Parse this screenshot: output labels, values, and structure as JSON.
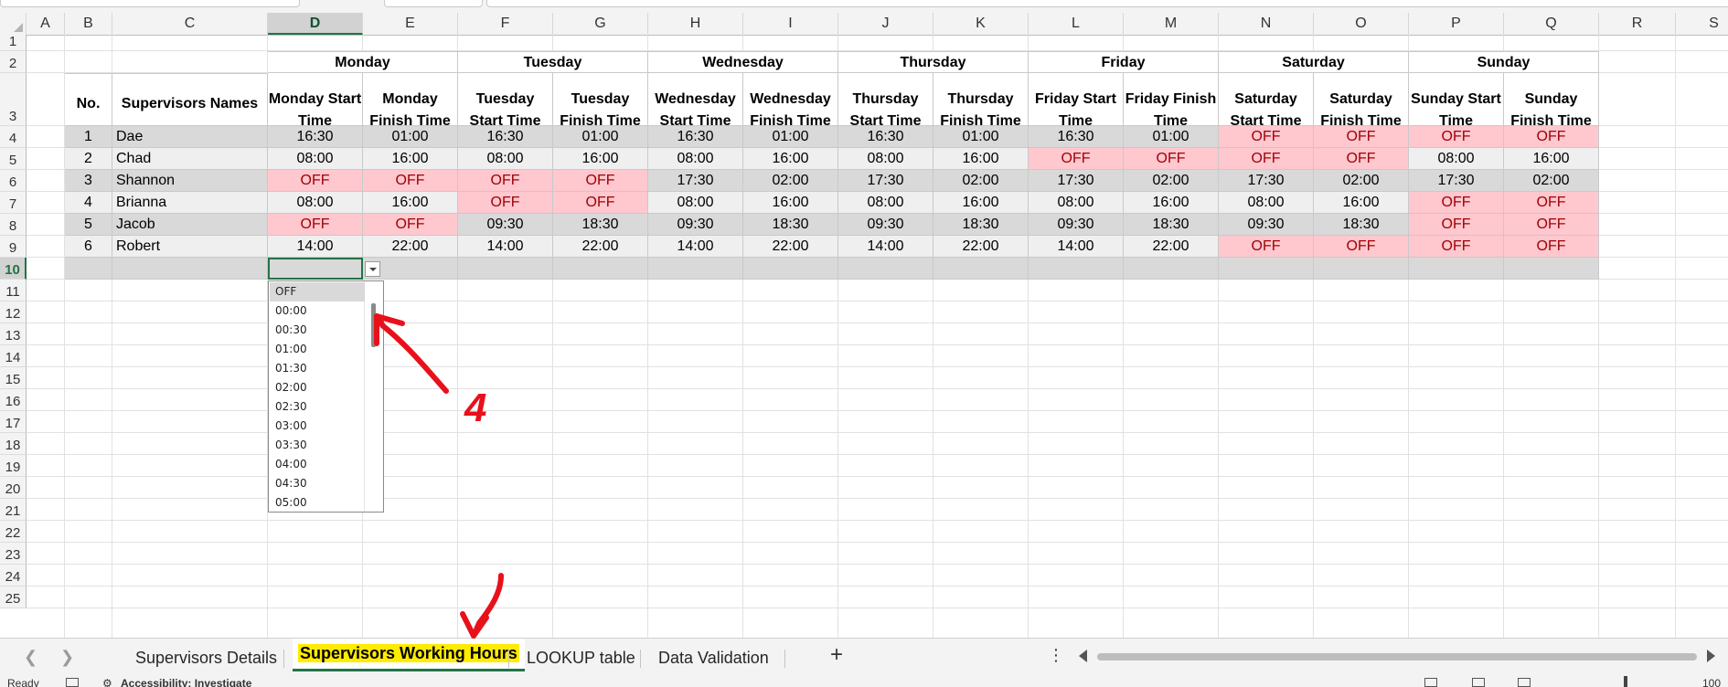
{
  "columns": [
    "A",
    "B",
    "C",
    "D",
    "E",
    "F",
    "G",
    "H",
    "I",
    "J",
    "K",
    "L",
    "M",
    "N",
    "O",
    "P",
    "Q",
    "R",
    "S"
  ],
  "selected_column": "D",
  "rows": [
    "1",
    "2",
    "3",
    "4",
    "5",
    "6",
    "7",
    "8",
    "9",
    "10",
    "11",
    "12",
    "13",
    "14",
    "15",
    "16",
    "17",
    "18",
    "19",
    "20",
    "21",
    "22",
    "23",
    "24",
    "25"
  ],
  "selected_row": "10",
  "table": {
    "day_headers": [
      "Monday",
      "Tuesday",
      "Wednesday",
      "Thursday",
      "Friday",
      "Saturday",
      "Sunday"
    ],
    "col_no": "No.",
    "col_name": "Supervisors Names",
    "sub_headers": [
      "Monday Start Time",
      "Monday Finish Time",
      "Tuesday Start Time",
      "Tuesday Finish Time",
      "Wednesday Start Time",
      "Wednesday Finish Time",
      "Thursday Start Time",
      "Thursday Finish Time",
      "Friday Start Time",
      "Friday Finish Time",
      "Saturday Start Time",
      "Saturday Finish Time",
      "Sunday Start Time",
      "Sunday Finish Time"
    ],
    "rows": [
      {
        "no": "1",
        "name": "Dae",
        "times": [
          "16:30",
          "01:00",
          "16:30",
          "01:00",
          "16:30",
          "01:00",
          "16:30",
          "01:00",
          "16:30",
          "01:00",
          "OFF",
          "OFF",
          "OFF",
          "OFF"
        ]
      },
      {
        "no": "2",
        "name": "Chad",
        "times": [
          "08:00",
          "16:00",
          "08:00",
          "16:00",
          "08:00",
          "16:00",
          "08:00",
          "16:00",
          "OFF",
          "OFF",
          "OFF",
          "OFF",
          "08:00",
          "16:00"
        ]
      },
      {
        "no": "3",
        "name": "Shannon",
        "times": [
          "OFF",
          "OFF",
          "OFF",
          "OFF",
          "17:30",
          "02:00",
          "17:30",
          "02:00",
          "17:30",
          "02:00",
          "17:30",
          "02:00",
          "17:30",
          "02:00"
        ]
      },
      {
        "no": "4",
        "name": "Brianna",
        "times": [
          "08:00",
          "16:00",
          "OFF",
          "OFF",
          "08:00",
          "16:00",
          "08:00",
          "16:00",
          "08:00",
          "16:00",
          "08:00",
          "16:00",
          "OFF",
          "OFF"
        ]
      },
      {
        "no": "5",
        "name": "Jacob",
        "times": [
          "OFF",
          "OFF",
          "09:30",
          "18:30",
          "09:30",
          "18:30",
          "09:30",
          "18:30",
          "09:30",
          "18:30",
          "09:30",
          "18:30",
          "OFF",
          "OFF"
        ]
      },
      {
        "no": "6",
        "name": "Robert",
        "times": [
          "14:00",
          "22:00",
          "14:00",
          "22:00",
          "14:00",
          "22:00",
          "14:00",
          "22:00",
          "14:00",
          "22:00",
          "OFF",
          "OFF",
          "OFF",
          "OFF"
        ]
      }
    ]
  },
  "dropdown": {
    "options": [
      "OFF",
      "00:00",
      "00:30",
      "01:00",
      "01:30",
      "02:00",
      "02:30",
      "03:00",
      "03:30",
      "04:00",
      "04:30",
      "05:00"
    ],
    "highlighted": "OFF"
  },
  "annotations": {
    "arrow_label": "4"
  },
  "sheet_tabs": [
    {
      "label": "Supervisors Details",
      "active": false
    },
    {
      "label": "Supervisors Working Hours",
      "active": true
    },
    {
      "label": "LOOKUP table",
      "active": false
    },
    {
      "label": "Data Validation",
      "active": false
    }
  ],
  "statusbar": {
    "ready": "Ready",
    "accessibility": "Accessibility: Investigate",
    "zoom": "100"
  },
  "colors": {
    "accent": "#217346",
    "off_fill": "#ffc7ce",
    "off_text": "#9c0006",
    "row_dark": "#d9d9d9",
    "row_light": "#efefef",
    "tab_highlight": "#ffeb00",
    "annotation": "#e8111b"
  }
}
